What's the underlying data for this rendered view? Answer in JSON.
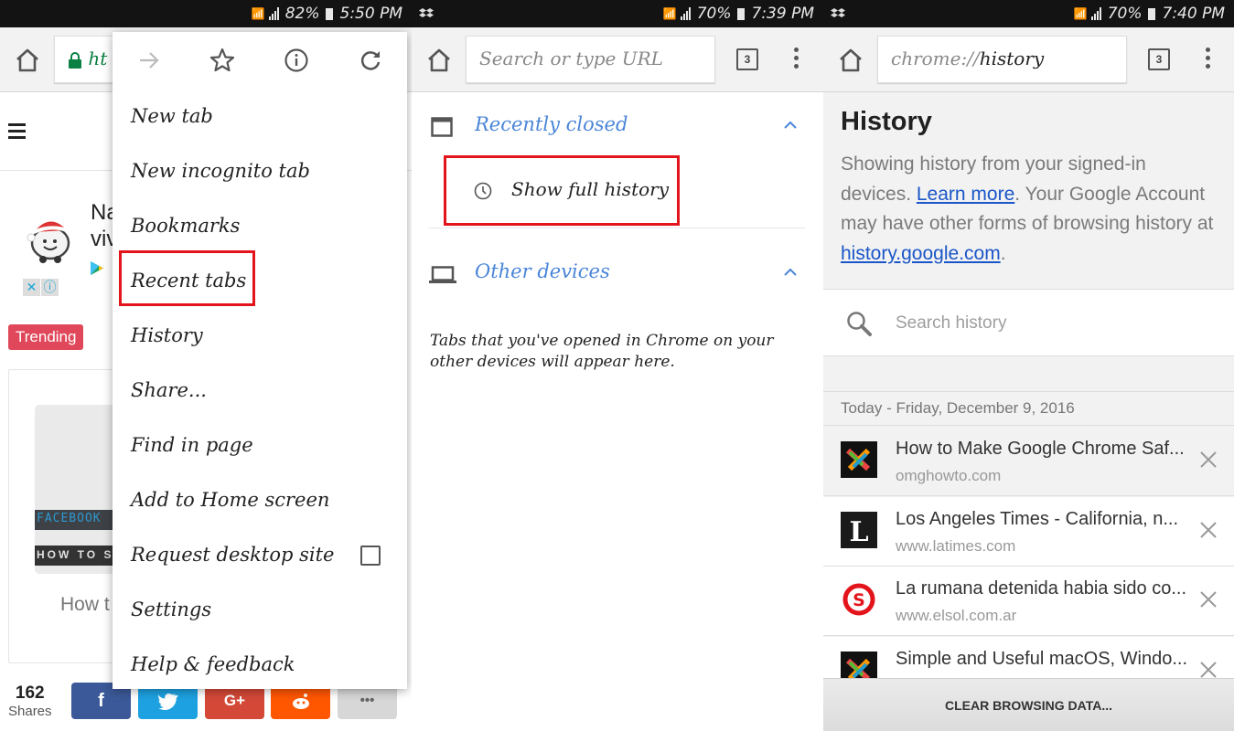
{
  "panel1": {
    "status": {
      "battery": "82%",
      "time": "5:50 PM"
    },
    "url_partial": "ht",
    "ad": {
      "title_partial_line1": "Na",
      "title_partial_line2": "viv",
      "close_label": "✕",
      "info_label": "ⓘ"
    },
    "trending_label": "Trending",
    "card": {
      "banner1": "FACEBOOK",
      "banner2": "HOW TO S",
      "caption_partial": "How t"
    },
    "shares": {
      "count": "162",
      "label": "Shares"
    },
    "social": [
      {
        "name": "facebook",
        "glyph": "f",
        "color": "#3b5998"
      },
      {
        "name": "twitter",
        "glyph": "🐦",
        "color": "#1da1e0"
      },
      {
        "name": "google-plus",
        "glyph": "G+",
        "color": "#d34836"
      },
      {
        "name": "reddit",
        "glyph": "◉",
        "color": "#ff5700"
      },
      {
        "name": "more",
        "glyph": "•••",
        "color": "#d7d7d7"
      }
    ],
    "menu": {
      "items": [
        {
          "label": "New tab"
        },
        {
          "label": "New incognito tab"
        },
        {
          "label": "Bookmarks"
        },
        {
          "label": "Recent tabs",
          "highlighted": true
        },
        {
          "label": "History"
        },
        {
          "label": "Share..."
        },
        {
          "label": "Find in page"
        },
        {
          "label": "Add to Home screen"
        },
        {
          "label": "Request desktop site",
          "checkbox": false
        },
        {
          "label": "Settings"
        },
        {
          "label": "Help & feedback"
        }
      ]
    }
  },
  "panel2": {
    "status": {
      "battery": "70%",
      "time": "7:39 PM"
    },
    "url_placeholder": "Search or type URL",
    "tab_count": "3",
    "recently_closed": {
      "label": "Recently closed",
      "show_full_history": "Show full history"
    },
    "other_devices": {
      "label": "Other devices",
      "note": "Tabs that you've opened in Chrome on your other devices will appear here."
    }
  },
  "panel3": {
    "status": {
      "battery": "70%",
      "time": "7:40 PM"
    },
    "url": {
      "scheme": "chrome://",
      "path": "history"
    },
    "tab_count": "3",
    "title": "History",
    "desc": {
      "part1": "Showing history from your signed-in devices. ",
      "learn_more": "Learn more",
      "part2": ". Your Google Account may have other forms of browsing history at ",
      "link": "history.google.com",
      "part3": "."
    },
    "search_placeholder": "Search history",
    "date_header": "Today - Friday, December 9, 2016",
    "entries": [
      {
        "title": "How to Make Google Chrome Saf...",
        "url": "omghowto.com",
        "favicon": "joomla"
      },
      {
        "title": "Los Angeles Times - California, n...",
        "url": "www.latimes.com",
        "favicon": "latimes"
      },
      {
        "title": "La rumana detenida habia sido co...",
        "url": "www.elsol.com.ar",
        "favicon": "elsol"
      },
      {
        "title": "Simple and Useful macOS, Windo...",
        "url": "",
        "favicon": "joomla"
      }
    ],
    "clear_button": "CLEAR BROWSING DATA..."
  },
  "colors": {
    "highlight": "#e3141b",
    "link": "#1a56c8",
    "accent_blue": "#4a85d8"
  }
}
